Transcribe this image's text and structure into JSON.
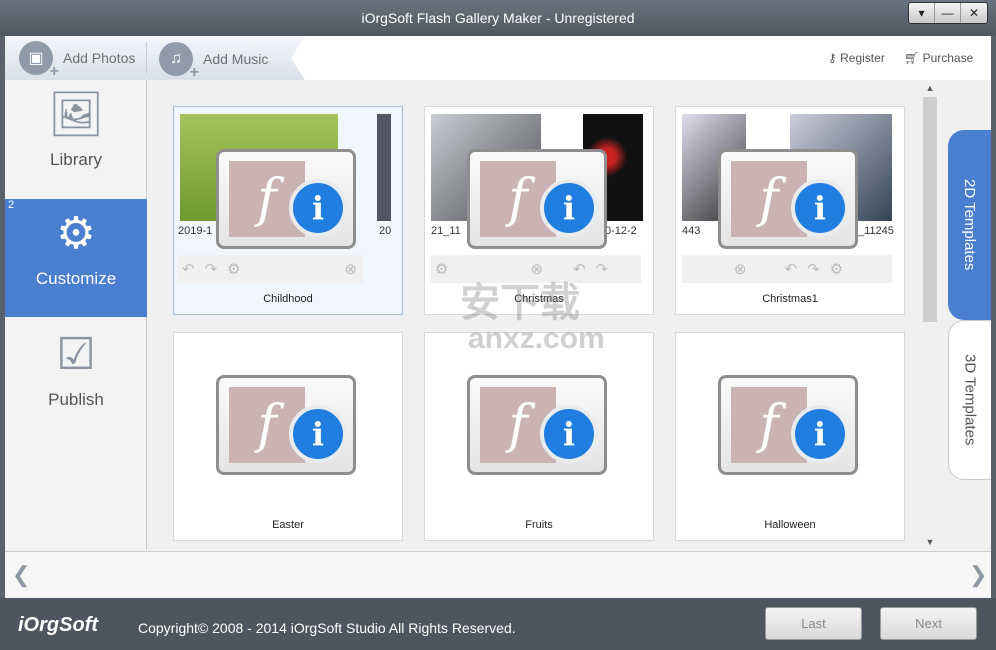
{
  "window": {
    "title": "iOrgSoft Flash Gallery Maker - Unregistered",
    "controls": [
      "▾",
      "—",
      "✕"
    ]
  },
  "toolbar": {
    "add_photos": "Add Photos",
    "add_music": "Add Music",
    "register": "Register",
    "purchase": "Purchase"
  },
  "sidebar": {
    "items": [
      {
        "label": "Library",
        "icon": "library-icon"
      },
      {
        "label": "Customize",
        "icon": "gear-icon",
        "badge": "2",
        "active": true
      },
      {
        "label": "Publish",
        "icon": "laptop-check-icon"
      }
    ]
  },
  "templates": [
    {
      "name": "Childhood",
      "captions": [
        "2019-1",
        "20"
      ],
      "selected": true
    },
    {
      "name": "Christmas",
      "captions": [
        "21_11",
        "0-12-2"
      ]
    },
    {
      "name": "Christmas1",
      "captions": [
        "443",
        "_11245"
      ]
    },
    {
      "name": "Easter"
    },
    {
      "name": "Fruits"
    },
    {
      "name": "Halloween"
    }
  ],
  "right_tabs": {
    "tab_2d": "2D Templates",
    "tab_3d": "3D Templates",
    "active": "2D Templates"
  },
  "footer": {
    "logo": "iOrgSoft",
    "copyright": "Copyright© 2008 - 2014 iOrgSoft Studio All Rights Reserved.",
    "last": "Last",
    "next": "Next"
  },
  "watermark": {
    "text_cn": "安下载",
    "text_en": "anxz.com"
  },
  "colors": {
    "accent": "#4a7ecf",
    "info": "#1f7ee0",
    "titlebar": "#5a616c"
  }
}
